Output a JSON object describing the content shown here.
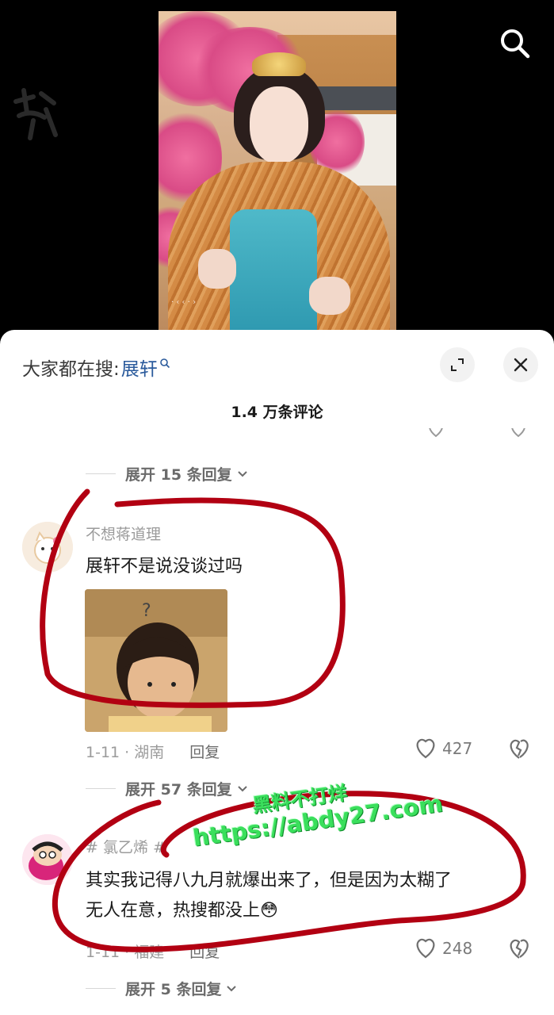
{
  "video": {
    "overlay_tag": "· ‹ ‹ · ›",
    "search_icon": "search-icon",
    "logo_icon": "brand-glyph-icon"
  },
  "sheet": {
    "suggest_prefix": "大家都在搜:",
    "suggest_term": "展轩",
    "expand_icon": "expand-icon",
    "close_icon": "close-icon",
    "comment_count": "1.4 万条评论"
  },
  "comments": [
    {
      "expand_above": "展开 15 条回复",
      "username": "不想蒋道理",
      "text": "展轩不是说没谈过吗",
      "date_region": "1-11 · 湖南",
      "reply_label": "回复",
      "likes": "427",
      "expand_below": "展开 57 条回复"
    },
    {
      "username": "# 氯乙烯 #",
      "text_line1": "其实我记得八九月就爆出来了，但是因为太糊了",
      "text_line2": "无人在意，热搜都没上",
      "emoji": "😳",
      "date_region": "1-11 · 福建",
      "reply_label": "回复",
      "likes": "248",
      "expand_below": "展开 5 条回复"
    }
  ],
  "watermark": {
    "line1": "黑料不打烊",
    "line2": "https://abdy27.com"
  },
  "colors": {
    "accent_blue": "#2b5b9c",
    "annotation_red": "#b20012",
    "watermark_green": "#3adf5c"
  }
}
